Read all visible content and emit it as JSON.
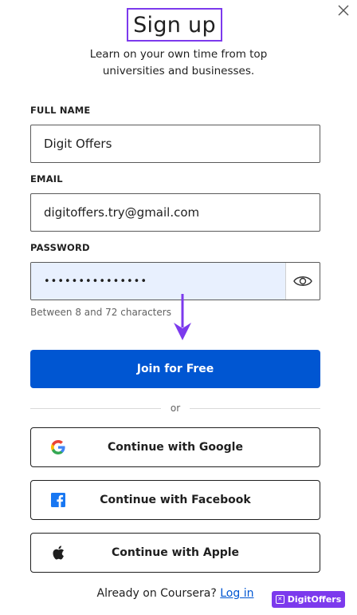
{
  "dialog": {
    "title": "Sign up",
    "subtitle_line1": "Learn on your own time from top",
    "subtitle_line2": "universities and businesses."
  },
  "form": {
    "full_name": {
      "label": "FULL NAME",
      "value": "Digit Offers"
    },
    "email": {
      "label": "EMAIL",
      "value": "digitoffers.try@gmail.com"
    },
    "password": {
      "label": "PASSWORD",
      "value_masked": "•••••••••••••••",
      "helper": "Between 8 and 72 characters",
      "toggle_icon": "eye-icon"
    }
  },
  "actions": {
    "join_label": "Join for Free",
    "divider": "or",
    "google_label": "Continue with Google",
    "facebook_label": "Continue with Facebook",
    "apple_label": "Continue with Apple"
  },
  "footer": {
    "text": "Already on Coursera?",
    "link": "Log in"
  },
  "watermark": {
    "brand": "DigitOffers"
  },
  "colors": {
    "primary": "#0056d2",
    "highlight": "#7c3aed",
    "password_fill": "#e8f0fe"
  }
}
